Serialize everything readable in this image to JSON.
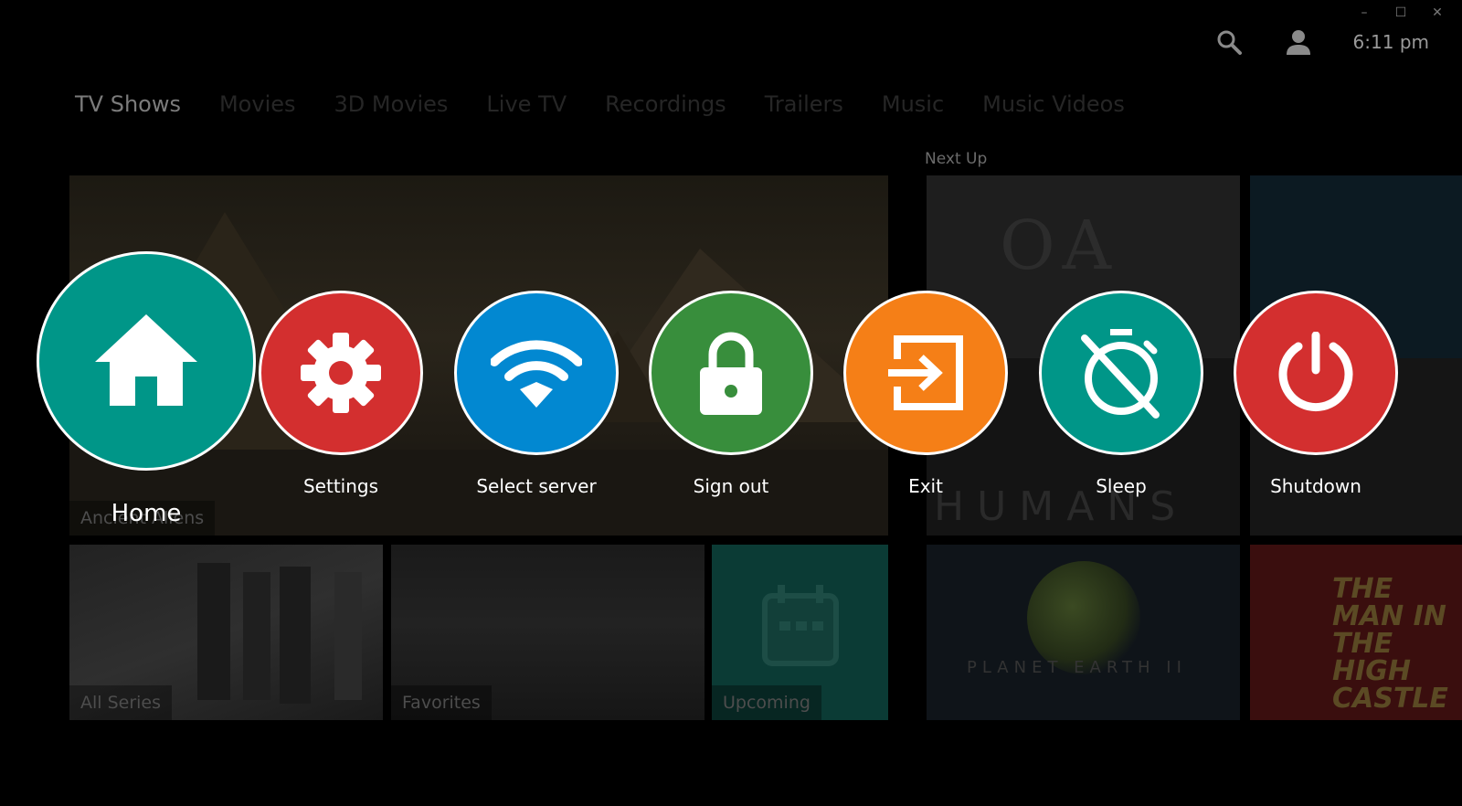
{
  "window_controls": [
    "–",
    "☐",
    "✕"
  ],
  "header": {
    "search_icon": "search-icon",
    "user_icon": "user-icon",
    "clock": "6:11 pm"
  },
  "tabs": [
    {
      "label": "TV Shows",
      "active": true
    },
    {
      "label": "Movies"
    },
    {
      "label": "3D Movies"
    },
    {
      "label": "Live TV"
    },
    {
      "label": "Recordings"
    },
    {
      "label": "Trailers"
    },
    {
      "label": "Music"
    },
    {
      "label": "Music Videos"
    }
  ],
  "next_up_heading": "Next Up",
  "tiles": {
    "hero_label": "Ancient Aliens",
    "all_series": "All Series",
    "favorites": "Favorites",
    "upcoming": "Upcoming",
    "oa_title": "OA",
    "humans_title": "HUMANS",
    "planet_title": "PLANET EARTH II",
    "man_title": "THE MAN IN THE HIGH CASTLE"
  },
  "menu": {
    "home": {
      "label": "Home",
      "color": "#009688"
    },
    "settings": {
      "label": "Settings",
      "color": "#d32f2f"
    },
    "select_server": {
      "label": "Select server",
      "color": "#0288d1"
    },
    "sign_out": {
      "label": "Sign out",
      "color": "#388e3c"
    },
    "exit": {
      "label": "Exit",
      "color": "#f57f17"
    },
    "sleep": {
      "label": "Sleep",
      "color": "#009688"
    },
    "shutdown": {
      "label": "Shutdown",
      "color": "#d32f2f"
    }
  }
}
